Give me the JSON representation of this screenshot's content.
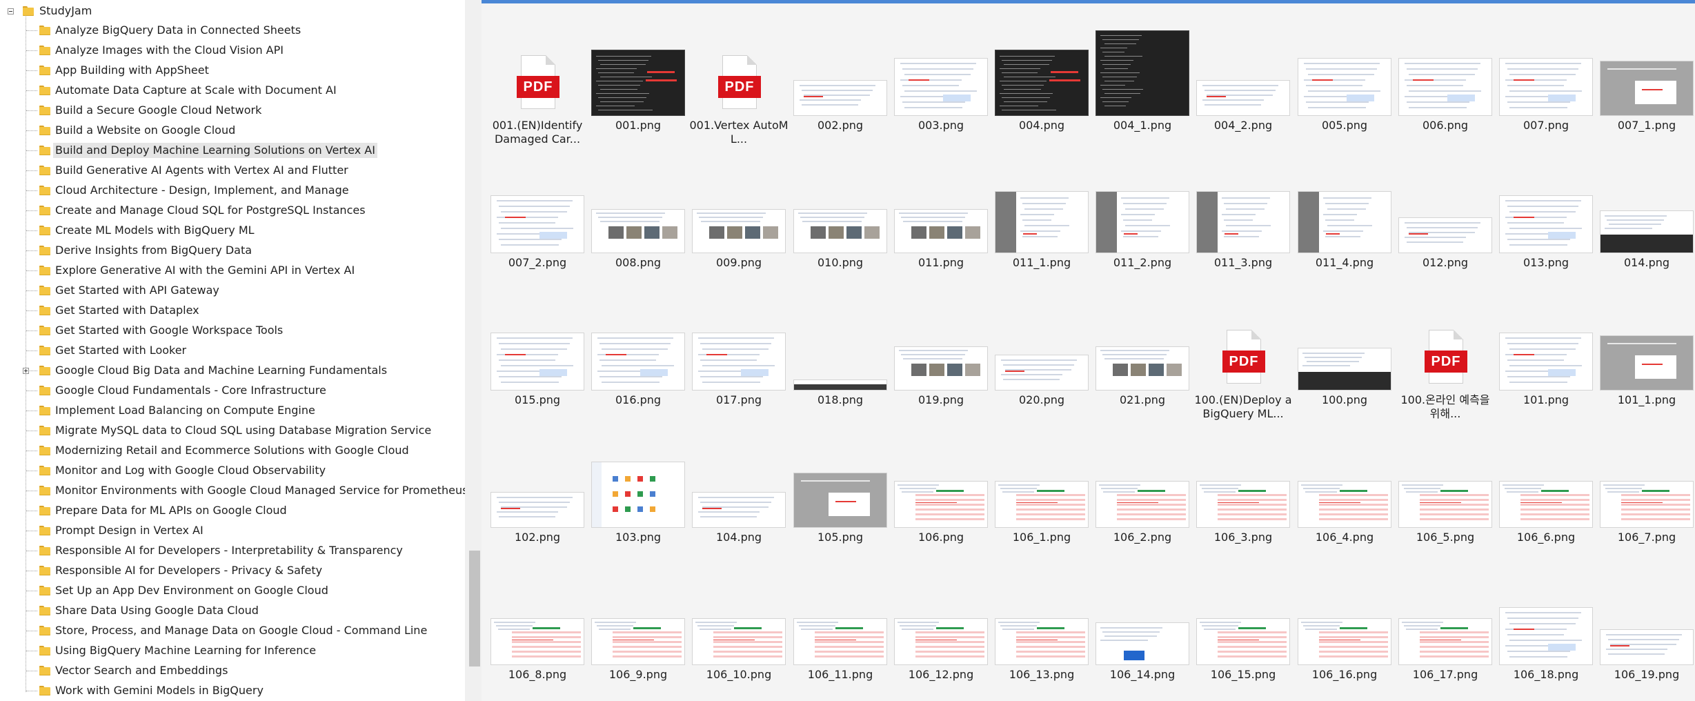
{
  "tree": {
    "root_label": "StudyJam",
    "selected_index": 6,
    "expandable_index": 17,
    "items": [
      "Analyze BigQuery Data in Connected Sheets",
      "Analyze Images with the Cloud Vision API",
      "App Building with AppSheet",
      "Automate Data Capture at Scale with Document AI",
      "Build a Secure Google Cloud Network",
      "Build a Website on Google Cloud",
      "Build and Deploy Machine Learning Solutions on Vertex AI",
      "Build Generative AI Agents with Vertex AI and Flutter",
      "Cloud Architecture - Design, Implement, and Manage",
      "Create and Manage Cloud SQL for PostgreSQL Instances",
      "Create ML Models with BigQuery ML",
      "Derive Insights from BigQuery Data",
      "Explore Generative AI with the Gemini API in Vertex AI",
      "Get Started with API Gateway",
      "Get Started with Dataplex",
      "Get Started with Google Workspace Tools",
      "Get Started with Looker",
      "Google Cloud Big Data and Machine Learning Fundamentals",
      "Google Cloud Fundamentals - Core Infrastructure",
      "Implement Load Balancing on Compute Engine",
      "Migrate MySQL data to Cloud SQL using Database Migration Service",
      "Modernizing Retail and Ecommerce Solutions with Google Cloud",
      "Monitor and Log with Google Cloud Observability",
      "Monitor Environments with Google Cloud Managed Service for Prometheus",
      "Prepare Data for ML APIs on Google Cloud",
      "Prompt Design in Vertex AI",
      "Responsible AI for Developers - Interpretability & Transparency",
      "Responsible AI for Developers - Privacy & Safety",
      "Set Up an App Dev Environment on Google Cloud",
      "Share Data Using Google Data Cloud",
      "Store, Process, and Manage Data on Google Cloud - Command Line",
      "Using BigQuery Machine Learning for Inference",
      "Vector Search and Embeddings",
      "Work with Gemini Models in BigQuery"
    ]
  },
  "pdf_badge_text": "PDF",
  "files": [
    {
      "label": "001.(EN)Identify Damaged Car...",
      "kind": "pdf"
    },
    {
      "label": "001.png",
      "kind": "dark"
    },
    {
      "label": "001.Vertex AutoML...",
      "kind": "pdf"
    },
    {
      "label": "002.png",
      "kind": "wide"
    },
    {
      "label": "003.png",
      "kind": "doc"
    },
    {
      "label": "004.png",
      "kind": "dark"
    },
    {
      "label": "004_1.png",
      "kind": "darktall"
    },
    {
      "label": "004_2.png",
      "kind": "wide"
    },
    {
      "label": "005.png",
      "kind": "doc"
    },
    {
      "label": "006.png",
      "kind": "doc"
    },
    {
      "label": "007.png",
      "kind": "doc"
    },
    {
      "label": "007_1.png",
      "kind": "gray"
    },
    {
      "label": "007_2.png",
      "kind": "doc"
    },
    {
      "label": "008.png",
      "kind": "photo"
    },
    {
      "label": "009.png",
      "kind": "photo"
    },
    {
      "label": "010.png",
      "kind": "photo"
    },
    {
      "label": "011.png",
      "kind": "photo"
    },
    {
      "label": "011_1.png",
      "kind": "sidebar"
    },
    {
      "label": "011_2.png",
      "kind": "sidebar"
    },
    {
      "label": "011_3.png",
      "kind": "sidebar"
    },
    {
      "label": "011_4.png",
      "kind": "sidebar"
    },
    {
      "label": "012.png",
      "kind": "wide"
    },
    {
      "label": "013.png",
      "kind": "doc"
    },
    {
      "label": "014.png",
      "kind": "darkbar"
    },
    {
      "label": "015.png",
      "kind": "doc"
    },
    {
      "label": "016.png",
      "kind": "doc"
    },
    {
      "label": "017.png",
      "kind": "doc"
    },
    {
      "label": "018.png",
      "kind": "strip"
    },
    {
      "label": "019.png",
      "kind": "photo"
    },
    {
      "label": "020.png",
      "kind": "wide"
    },
    {
      "label": "021.png",
      "kind": "photo"
    },
    {
      "label": "100.(EN)Deploy a BigQuery ML...",
      "kind": "pdf"
    },
    {
      "label": "100.png",
      "kind": "darkbar"
    },
    {
      "label": "100.온라인 예측을 위해...",
      "kind": "pdf"
    },
    {
      "label": "101.png",
      "kind": "doc"
    },
    {
      "label": "101_1.png",
      "kind": "gray"
    },
    {
      "label": "102.png",
      "kind": "wide"
    },
    {
      "label": "103.png",
      "kind": "icons"
    },
    {
      "label": "104.png",
      "kind": "wide"
    },
    {
      "label": "105.png",
      "kind": "gray"
    },
    {
      "label": "106.png",
      "kind": "table"
    },
    {
      "label": "106_1.png",
      "kind": "table"
    },
    {
      "label": "106_2.png",
      "kind": "table"
    },
    {
      "label": "106_3.png",
      "kind": "table"
    },
    {
      "label": "106_4.png",
      "kind": "table"
    },
    {
      "label": "106_5.png",
      "kind": "table"
    },
    {
      "label": "106_6.png",
      "kind": "table"
    },
    {
      "label": "106_7.png",
      "kind": "table"
    },
    {
      "label": "106_8.png",
      "kind": "table"
    },
    {
      "label": "106_9.png",
      "kind": "table"
    },
    {
      "label": "106_10.png",
      "kind": "table"
    },
    {
      "label": "106_11.png",
      "kind": "table"
    },
    {
      "label": "106_12.png",
      "kind": "table"
    },
    {
      "label": "106_13.png",
      "kind": "table"
    },
    {
      "label": "106_14.png",
      "kind": "chart"
    },
    {
      "label": "106_15.png",
      "kind": "table"
    },
    {
      "label": "106_16.png",
      "kind": "table"
    },
    {
      "label": "106_17.png",
      "kind": "table"
    },
    {
      "label": "106_18.png",
      "kind": "doc"
    },
    {
      "label": "106_19.png",
      "kind": "wide"
    }
  ]
}
